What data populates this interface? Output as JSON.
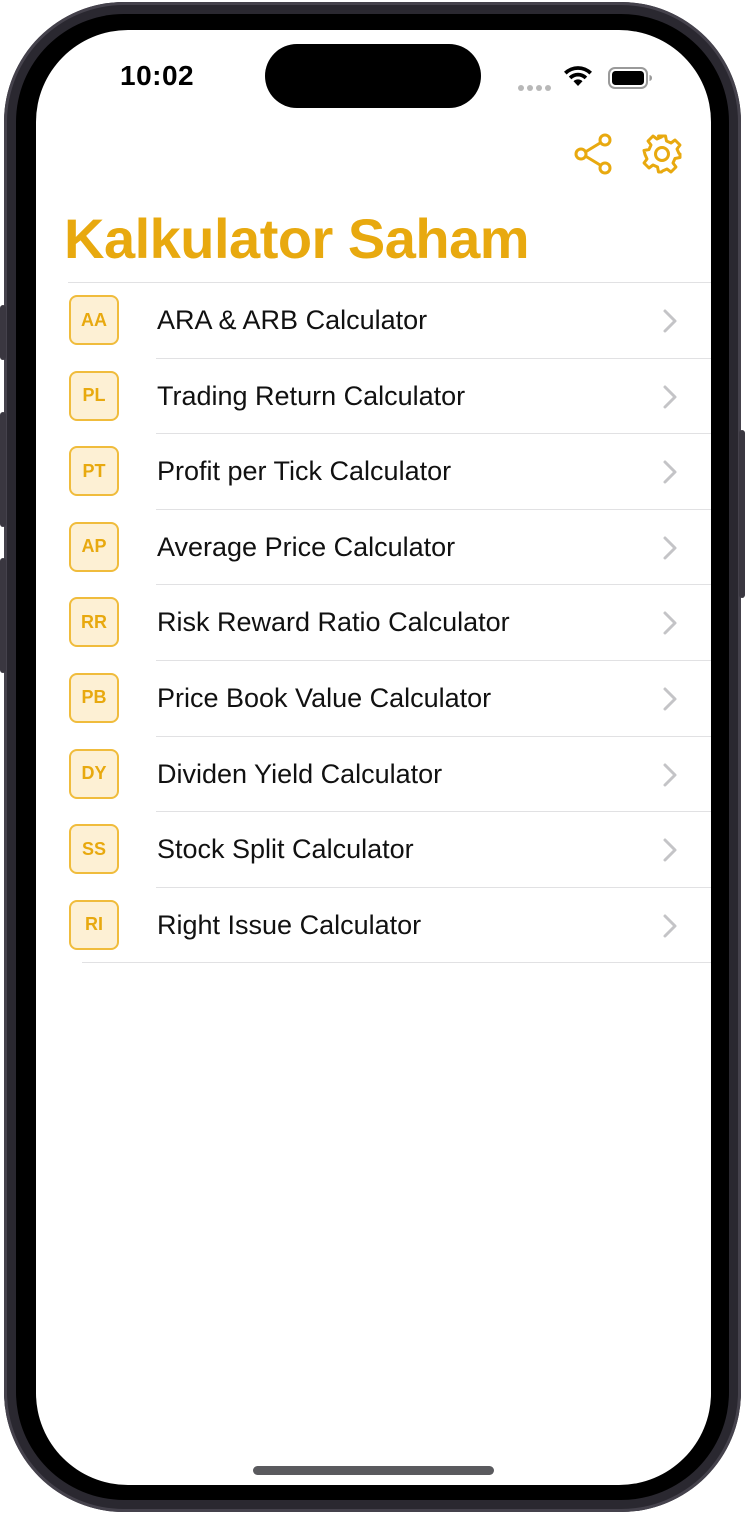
{
  "status_bar": {
    "time": "10:02"
  },
  "nav": {
    "share_icon": "share-icon",
    "settings_icon": "gear-icon"
  },
  "header": {
    "title": "Kalkulator Saham"
  },
  "colors": {
    "accent": "#e8a90f",
    "badge_bg": "#fdf0d4",
    "badge_border": "#f0bc3c",
    "separator": "#e1e1e3",
    "chevron": "#c4c4c7"
  },
  "calculators": [
    {
      "badge": "AA",
      "label": "ARA & ARB Calculator"
    },
    {
      "badge": "PL",
      "label": "Trading Return Calculator"
    },
    {
      "badge": "PT",
      "label": "Profit per Tick Calculator"
    },
    {
      "badge": "AP",
      "label": "Average Price Calculator"
    },
    {
      "badge": "RR",
      "label": "Risk Reward Ratio Calculator"
    },
    {
      "badge": "PB",
      "label": "Price Book Value Calculator"
    },
    {
      "badge": "DY",
      "label": "Dividen Yield Calculator"
    },
    {
      "badge": "SS",
      "label": "Stock Split Calculator"
    },
    {
      "badge": "RI",
      "label": "Right Issue Calculator"
    }
  ]
}
